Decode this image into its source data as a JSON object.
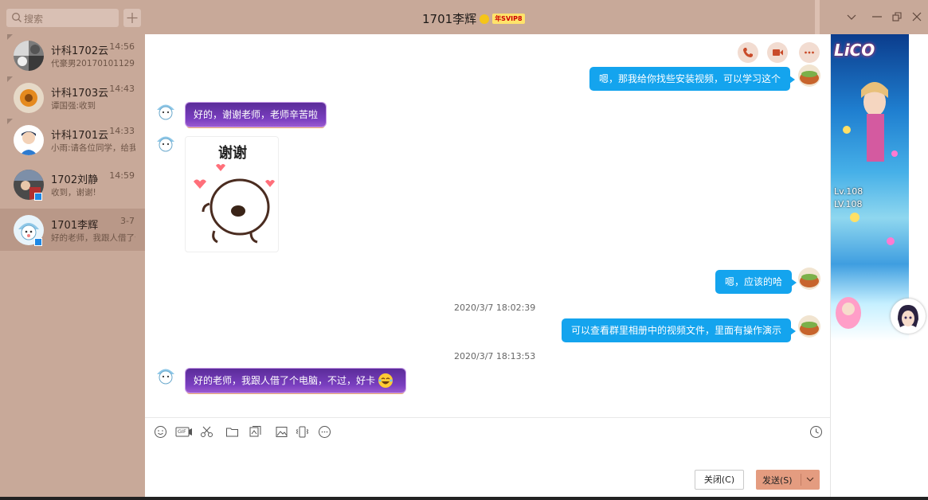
{
  "search": {
    "placeholder": "搜索"
  },
  "conversations": [
    {
      "name": "计科1702云",
      "time": "14:56",
      "preview": "代豪男20170101129",
      "pinned": true
    },
    {
      "name": "计科1703云",
      "time": "14:43",
      "preview": "谭国强:收到",
      "pinned": true
    },
    {
      "name": "计科1701云",
      "time": "14:33",
      "preview": "小雨:请各位同学，给我",
      "pinned": true
    },
    {
      "name": "1702刘静",
      "time": "14:59",
      "preview": "收到，谢谢!",
      "pinned": false
    },
    {
      "name": "1701李辉",
      "time": "3-7",
      "preview": "好的老师，我跟人借了个",
      "pinned": false,
      "active": true
    }
  ],
  "header": {
    "title": "1701李辉",
    "vip_badge": "年SVIP8"
  },
  "messages": [
    {
      "direction": "out",
      "text": "嗯，那我给你找些安装视频，可以学习这个"
    },
    {
      "direction": "in",
      "text": "好的，谢谢老师，老师辛苦啦"
    },
    {
      "direction": "in",
      "type": "sticker",
      "text": "谢谢"
    },
    {
      "direction": "out",
      "text": "嗯，应该的哈"
    },
    {
      "type": "timestamp",
      "text": "2020/3/7 18:02:39"
    },
    {
      "direction": "out",
      "text": "可以查看群里相册中的视频文件，里面有操作演示"
    },
    {
      "type": "timestamp",
      "text": "2020/3/7 18:13:53"
    },
    {
      "direction": "in",
      "text": "好的老师，我跟人借了个电脑，不过，好卡"
    }
  ],
  "toolbar": {
    "icons": [
      "emoji-icon",
      "gif-icon",
      "scissors-icon",
      "folder-icon",
      "gallery-icon",
      "image-icon",
      "shake-icon",
      "more-icon",
      "history-icon"
    ],
    "gif_label": "GIF"
  },
  "buttons": {
    "close_label": "关闭(C)",
    "send_label": "发送(S)"
  },
  "ad": {
    "logo_text": "LiCO",
    "level_1": "Lv.108",
    "level_2": "LV.108"
  },
  "colors": {
    "sidebar": "#c8a999",
    "bubble_out": "#14a4ee",
    "bubble_in": "#6a33ad",
    "send_button": "#e49c80"
  }
}
